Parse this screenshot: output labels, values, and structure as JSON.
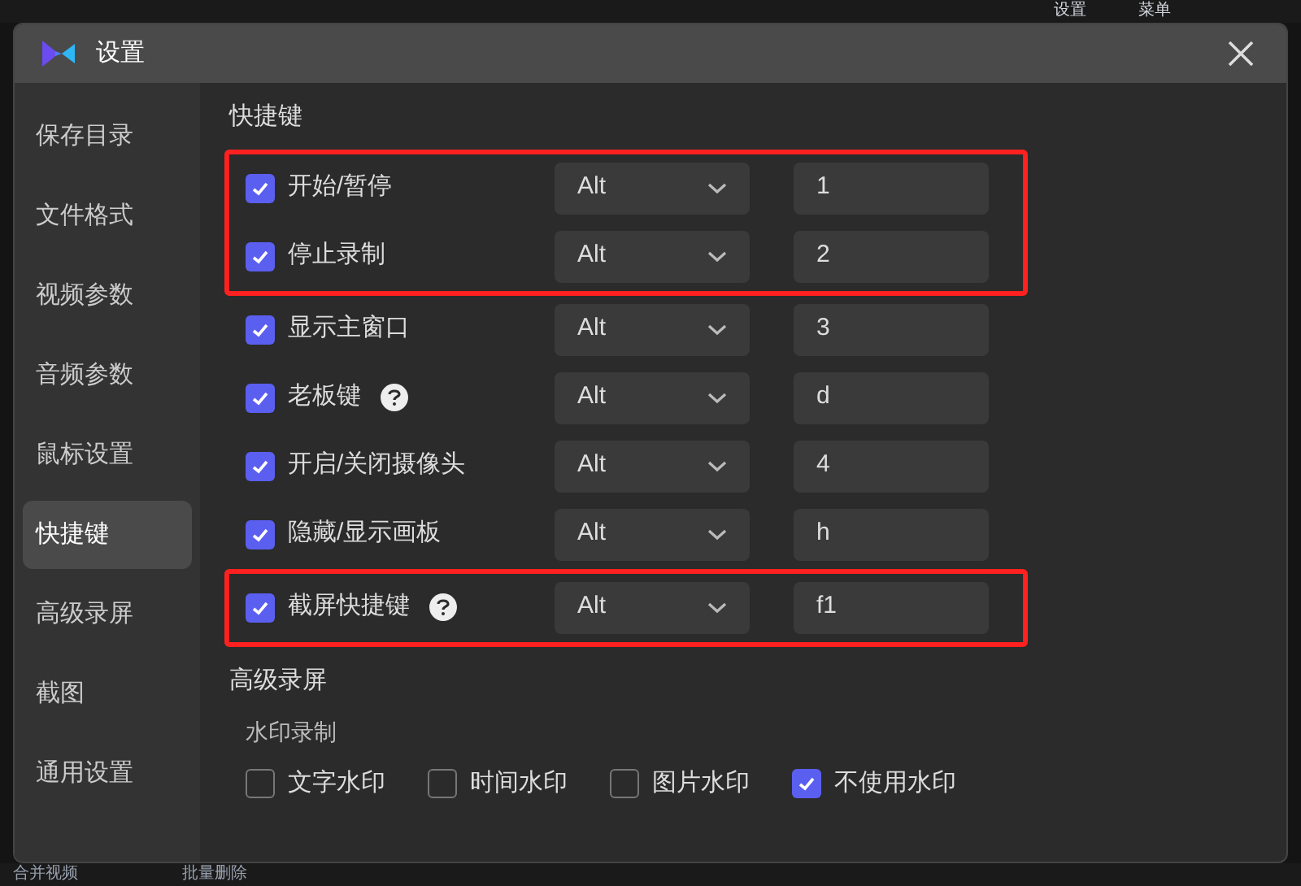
{
  "background_app": {
    "top_items": [
      "设置",
      "菜单"
    ],
    "bottom_items": [
      "合并视频",
      "批量删除"
    ]
  },
  "window": {
    "title": "设置"
  },
  "sidebar": {
    "items": [
      {
        "label": "保存目录",
        "selected": false
      },
      {
        "label": "文件格式",
        "selected": false
      },
      {
        "label": "视频参数",
        "selected": false
      },
      {
        "label": "音频参数",
        "selected": false
      },
      {
        "label": "鼠标设置",
        "selected": false
      },
      {
        "label": "快捷键",
        "selected": true
      },
      {
        "label": "高级录屏",
        "selected": false
      },
      {
        "label": "截图",
        "selected": false
      },
      {
        "label": "通用设置",
        "selected": false
      }
    ]
  },
  "shortcuts": {
    "heading": "快捷键",
    "rows": [
      {
        "label": "开始/暂停",
        "checked": true,
        "help": false,
        "modifier": "Alt",
        "key": "1",
        "highlighted": true
      },
      {
        "label": "停止录制",
        "checked": true,
        "help": false,
        "modifier": "Alt",
        "key": "2",
        "highlighted": true
      },
      {
        "label": "显示主窗口",
        "checked": true,
        "help": false,
        "modifier": "Alt",
        "key": "3",
        "highlighted": false
      },
      {
        "label": "老板键",
        "checked": true,
        "help": true,
        "modifier": "Alt",
        "key": "d",
        "highlighted": false
      },
      {
        "label": "开启/关闭摄像头",
        "checked": true,
        "help": false,
        "modifier": "Alt",
        "key": "4",
        "highlighted": false
      },
      {
        "label": "隐藏/显示画板",
        "checked": true,
        "help": false,
        "modifier": "Alt",
        "key": "h",
        "highlighted": false
      },
      {
        "label": "截屏快捷键",
        "checked": true,
        "help": true,
        "modifier": "Alt",
        "key": "f1",
        "highlighted": true
      }
    ]
  },
  "advanced": {
    "heading": "高级录屏",
    "subheading": "水印录制",
    "watermark_options": [
      {
        "label": "文字水印",
        "checked": false
      },
      {
        "label": "时间水印",
        "checked": false
      },
      {
        "label": "图片水印",
        "checked": false
      },
      {
        "label": "不使用水印",
        "checked": true
      }
    ]
  }
}
